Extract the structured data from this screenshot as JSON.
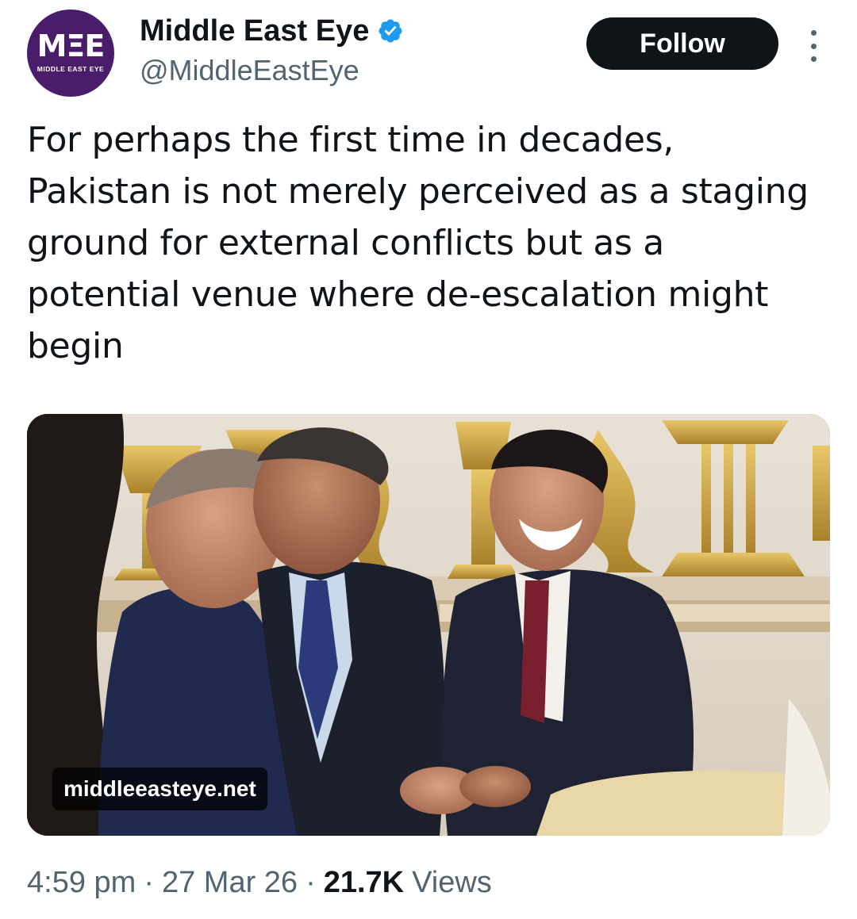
{
  "account": {
    "display_name": "Middle East Eye",
    "handle": "@MiddleEastEye",
    "verified": true,
    "avatar_logo": "MΞE",
    "avatar_subtitle": "MIDDLE EAST EYE"
  },
  "follow_label": "Follow",
  "tweet_text": "For perhaps the first time in decades, Pakistan is not merely perceived as a staging ground for external conflicts but as a potential venue where de-escalation might begin",
  "media": {
    "link_domain": "middleeasteye.net"
  },
  "meta": {
    "time": "4:59 pm",
    "date": "27 Mar 26",
    "views_count": "21.7K",
    "views_label": "Views"
  },
  "colors": {
    "text": "#0f1419",
    "secondary": "#536471",
    "verified_blue": "#1d9bf0",
    "avatar_bg": "#4a1d6b"
  }
}
